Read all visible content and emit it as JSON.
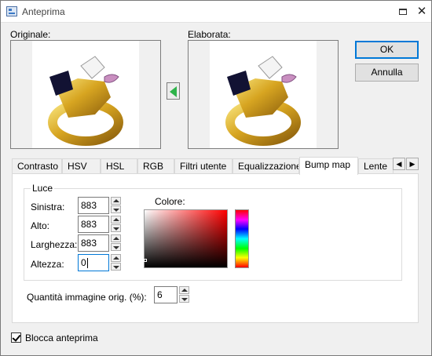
{
  "window": {
    "title": "Anteprima",
    "icon": "app-preview-icon"
  },
  "panels": {
    "original_label": "Originale:",
    "processed_label": "Elaborata:"
  },
  "buttons": {
    "ok": "OK",
    "cancel": "Annulla"
  },
  "tabs": [
    {
      "label": "Contrasto",
      "active": false
    },
    {
      "label": "HSV",
      "active": false
    },
    {
      "label": "HSL",
      "active": false
    },
    {
      "label": "RGB",
      "active": false
    },
    {
      "label": "Filtri utente",
      "active": false
    },
    {
      "label": "Equalizzazione",
      "active": false
    },
    {
      "label": "Bump map",
      "active": true
    },
    {
      "label": "Lente",
      "active": false
    }
  ],
  "bump_map": {
    "group_title": "Luce",
    "fields": [
      {
        "label": "Sinistra:",
        "value": "883"
      },
      {
        "label": "Alto:",
        "value": "883"
      },
      {
        "label": "Larghezza:",
        "value": "883"
      },
      {
        "label": "Altezza:",
        "value": "0"
      }
    ],
    "color_label": "Colore:",
    "selected_hue": "#ff0000",
    "orig_amount_label": "Quantità immagine orig. (%):",
    "orig_amount_value": "6"
  },
  "lock_preview": {
    "label": "Blocca anteprima",
    "checked": true
  }
}
